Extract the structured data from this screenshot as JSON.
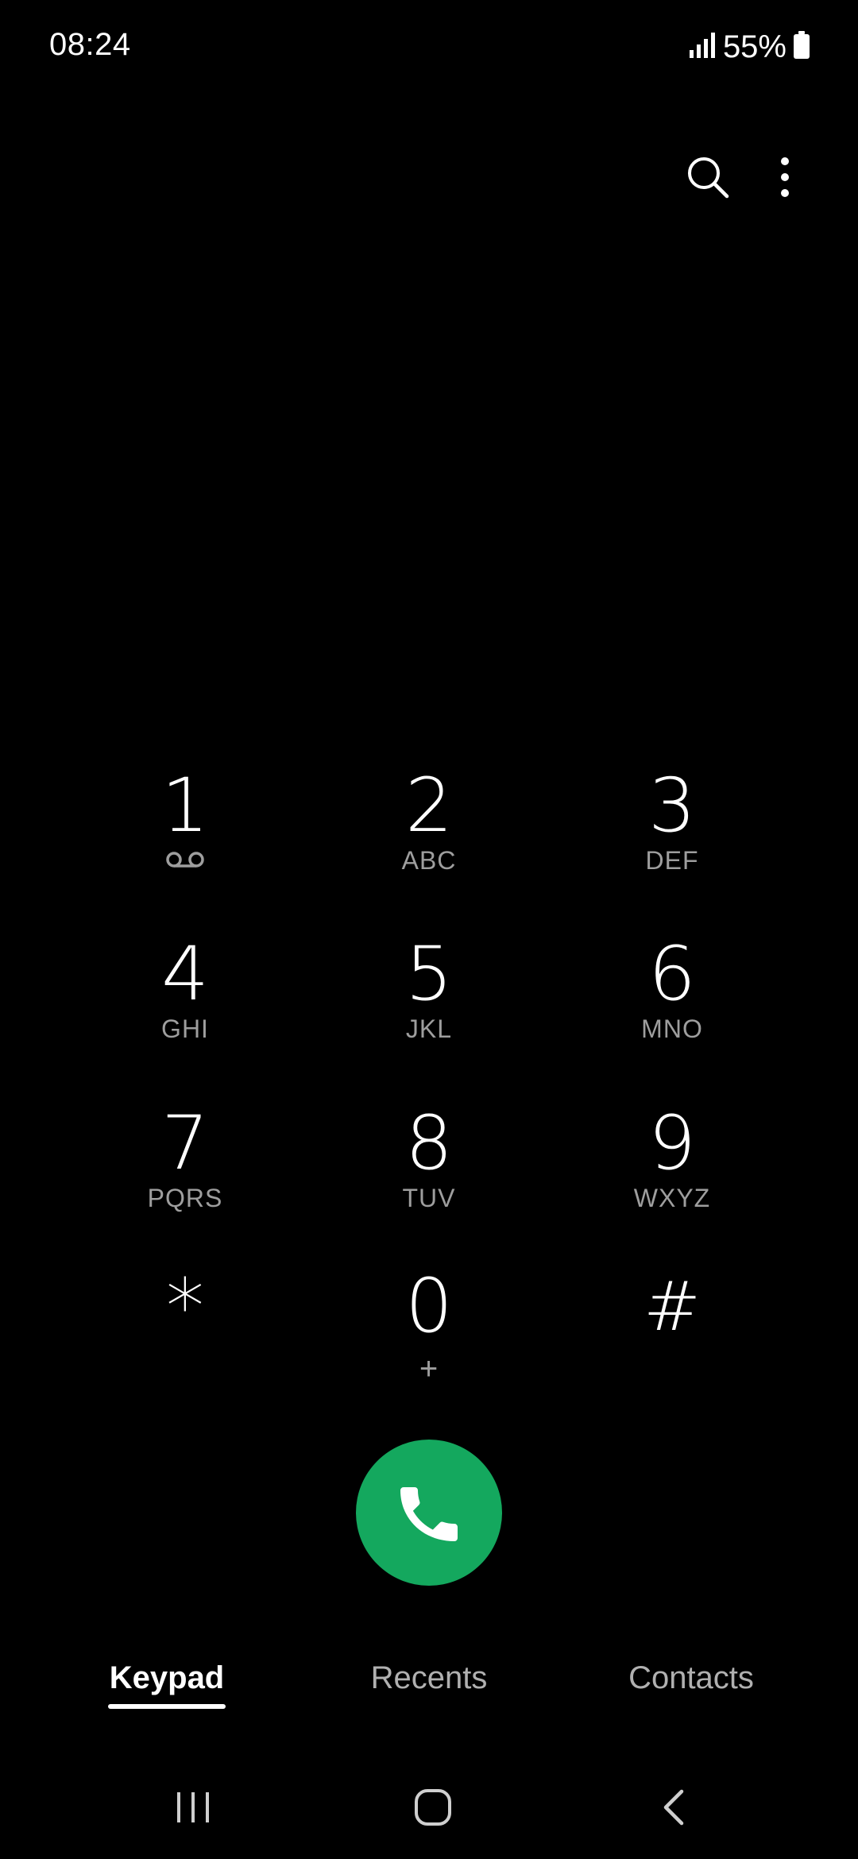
{
  "status": {
    "time": "08:24",
    "battery": "55%",
    "icons": [
      "signal-icon",
      "battery-icon"
    ]
  },
  "toolbar": {
    "icons": [
      "search-icon",
      "more-vert-icon"
    ]
  },
  "keypad": {
    "keys": [
      {
        "digit": "1",
        "letters": "",
        "sub_icon": "voicemail-icon"
      },
      {
        "digit": "2",
        "letters": "ABC"
      },
      {
        "digit": "3",
        "letters": "DEF"
      },
      {
        "digit": "4",
        "letters": "GHI"
      },
      {
        "digit": "5",
        "letters": "JKL"
      },
      {
        "digit": "6",
        "letters": "MNO"
      },
      {
        "digit": "7",
        "letters": "PQRS"
      },
      {
        "digit": "8",
        "letters": "TUV"
      },
      {
        "digit": "9",
        "letters": "WXYZ"
      },
      {
        "digit": "*",
        "letters": ""
      },
      {
        "digit": "0",
        "letters": "+"
      },
      {
        "digit": "#",
        "letters": ""
      }
    ]
  },
  "call": {
    "icon": "phone-icon",
    "color": "#14a85e"
  },
  "tabs": [
    {
      "label": "Keypad",
      "active": true
    },
    {
      "label": "Recents",
      "active": false
    },
    {
      "label": "Contacts",
      "active": false
    }
  ],
  "nav": {
    "icons": [
      "recents-nav-icon",
      "home-nav-icon",
      "back-nav-icon"
    ]
  }
}
